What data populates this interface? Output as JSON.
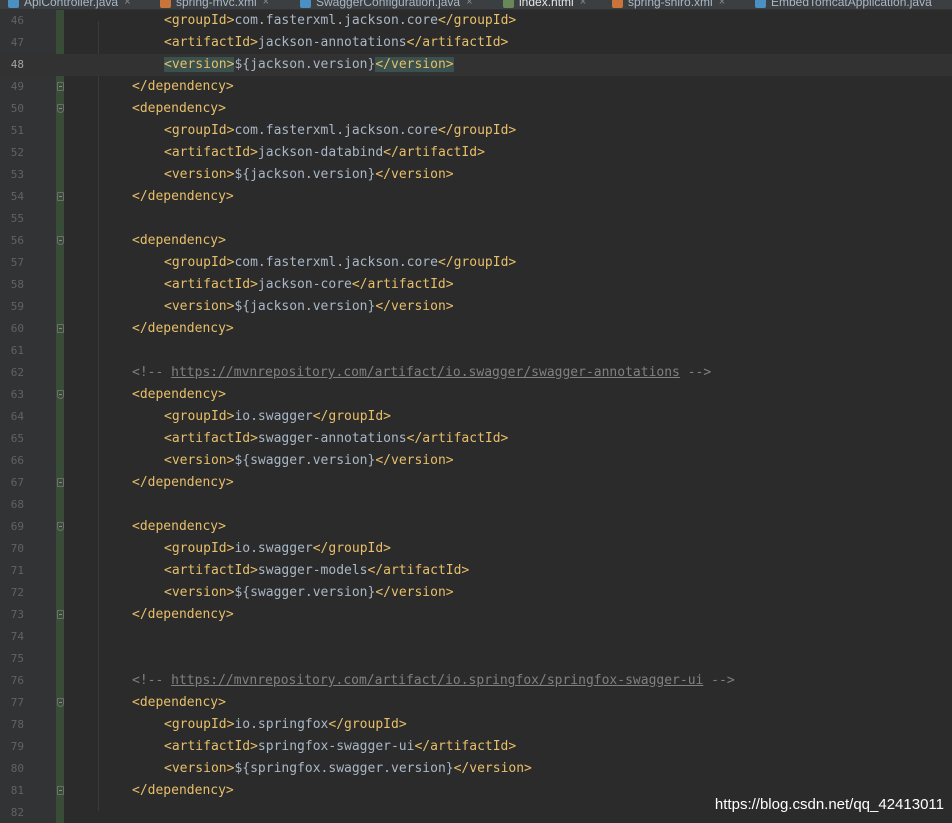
{
  "tabs": [
    {
      "label": "ApiController.java",
      "icon": "java-class-icon",
      "color": "#4a90c2",
      "active": false
    },
    {
      "label": "spring-mvc.xml",
      "icon": "spring-xml-icon",
      "color": "#c8743a",
      "active": false
    },
    {
      "label": "SwaggerConfiguration.java",
      "icon": "java-class-icon",
      "color": "#4a90c2",
      "active": false
    },
    {
      "label": "index.html",
      "icon": "html-file-icon",
      "color": "#6a8759",
      "active": true
    },
    {
      "label": "spring-shiro.xml",
      "icon": "spring-xml-icon",
      "color": "#c8743a",
      "active": false
    },
    {
      "label": "EmbedTomcatApplication.java",
      "icon": "java-class-icon",
      "color": "#4a90c2",
      "active": false
    }
  ],
  "editor": {
    "current_line": 48,
    "lines": [
      {
        "n": "46",
        "tokens": [
          {
            "c": "t",
            "s": "<groupId>"
          },
          {
            "c": "txt",
            "s": "com.fasterxml.jackson.core"
          },
          {
            "c": "t",
            "s": "</groupId>"
          }
        ]
      },
      {
        "n": "47",
        "tokens": [
          {
            "c": "t",
            "s": "<artifactId>"
          },
          {
            "c": "txt",
            "s": "jackson-annotations"
          },
          {
            "c": "t",
            "s": "</artifactId>"
          }
        ]
      },
      {
        "n": "48",
        "tokens": [
          {
            "c": "t hl",
            "s": "<version>"
          },
          {
            "c": "txt",
            "s": "${jackson.version}"
          },
          {
            "c": "t hl",
            "s": "</version>"
          }
        ]
      },
      {
        "n": "49",
        "tokens": [
          {
            "c": "t",
            "s": "</dependency>"
          }
        ]
      },
      {
        "n": "50",
        "tokens": [
          {
            "c": "t",
            "s": "<dependency>"
          }
        ]
      },
      {
        "n": "51",
        "tokens": [
          {
            "c": "t",
            "s": "<groupId>"
          },
          {
            "c": "txt",
            "s": "com.fasterxml.jackson.core"
          },
          {
            "c": "t",
            "s": "</groupId>"
          }
        ]
      },
      {
        "n": "52",
        "tokens": [
          {
            "c": "t",
            "s": "<artifactId>"
          },
          {
            "c": "txt",
            "s": "jackson-databind"
          },
          {
            "c": "t",
            "s": "</artifactId>"
          }
        ]
      },
      {
        "n": "53",
        "tokens": [
          {
            "c": "t",
            "s": "<version>"
          },
          {
            "c": "txt",
            "s": "${jackson.version}"
          },
          {
            "c": "t",
            "s": "</version>"
          }
        ]
      },
      {
        "n": "54",
        "tokens": [
          {
            "c": "t",
            "s": "</dependency>"
          }
        ]
      },
      {
        "n": "55",
        "tokens": []
      },
      {
        "n": "56",
        "tokens": [
          {
            "c": "t",
            "s": "<dependency>"
          }
        ]
      },
      {
        "n": "57",
        "tokens": [
          {
            "c": "t",
            "s": "<groupId>"
          },
          {
            "c": "txt",
            "s": "com.fasterxml.jackson.core"
          },
          {
            "c": "t",
            "s": "</groupId>"
          }
        ]
      },
      {
        "n": "58",
        "tokens": [
          {
            "c": "t",
            "s": "<artifactId>"
          },
          {
            "c": "txt",
            "s": "jackson-core"
          },
          {
            "c": "t",
            "s": "</artifactId>"
          }
        ]
      },
      {
        "n": "59",
        "tokens": [
          {
            "c": "t",
            "s": "<version>"
          },
          {
            "c": "txt",
            "s": "${jackson.version}"
          },
          {
            "c": "t",
            "s": "</version>"
          }
        ]
      },
      {
        "n": "60",
        "tokens": [
          {
            "c": "t",
            "s": "</dependency>"
          }
        ]
      },
      {
        "n": "61",
        "tokens": []
      },
      {
        "n": "62",
        "tokens": [
          {
            "c": "cmt",
            "s": "<!-- "
          },
          {
            "c": "url",
            "s": "https://mvnrepository.com/artifact/io.swagger/swagger-annotations"
          },
          {
            "c": "cmt",
            "s": " -->"
          }
        ]
      },
      {
        "n": "63",
        "tokens": [
          {
            "c": "t",
            "s": "<dependency>"
          }
        ]
      },
      {
        "n": "64",
        "tokens": [
          {
            "c": "t",
            "s": "<groupId>"
          },
          {
            "c": "txt",
            "s": "io.swagger"
          },
          {
            "c": "t",
            "s": "</groupId>"
          }
        ]
      },
      {
        "n": "65",
        "tokens": [
          {
            "c": "t",
            "s": "<artifactId>"
          },
          {
            "c": "txt",
            "s": "swagger-annotations"
          },
          {
            "c": "t",
            "s": "</artifactId>"
          }
        ]
      },
      {
        "n": "66",
        "tokens": [
          {
            "c": "t",
            "s": "<version>"
          },
          {
            "c": "txt",
            "s": "${swagger.version}"
          },
          {
            "c": "t",
            "s": "</version>"
          }
        ]
      },
      {
        "n": "67",
        "tokens": [
          {
            "c": "t",
            "s": "</dependency>"
          }
        ]
      },
      {
        "n": "68",
        "tokens": []
      },
      {
        "n": "69",
        "tokens": [
          {
            "c": "t",
            "s": "<dependency>"
          }
        ]
      },
      {
        "n": "70",
        "tokens": [
          {
            "c": "t",
            "s": "<groupId>"
          },
          {
            "c": "txt",
            "s": "io.swagger"
          },
          {
            "c": "t",
            "s": "</groupId>"
          }
        ]
      },
      {
        "n": "71",
        "tokens": [
          {
            "c": "t",
            "s": "<artifactId>"
          },
          {
            "c": "txt",
            "s": "swagger-models"
          },
          {
            "c": "t",
            "s": "</artifactId>"
          }
        ]
      },
      {
        "n": "72",
        "tokens": [
          {
            "c": "t",
            "s": "<version>"
          },
          {
            "c": "txt",
            "s": "${swagger.version}"
          },
          {
            "c": "t",
            "s": "</version>"
          }
        ]
      },
      {
        "n": "73",
        "tokens": [
          {
            "c": "t",
            "s": "</dependency>"
          }
        ]
      },
      {
        "n": "74",
        "tokens": []
      },
      {
        "n": "75",
        "tokens": []
      },
      {
        "n": "76",
        "tokens": [
          {
            "c": "cmt",
            "s": "<!-- "
          },
          {
            "c": "url",
            "s": "https://mvnrepository.com/artifact/io.springfox/springfox-swagger-ui"
          },
          {
            "c": "cmt",
            "s": " -->"
          }
        ]
      },
      {
        "n": "77",
        "tokens": [
          {
            "c": "t",
            "s": "<dependency>"
          }
        ]
      },
      {
        "n": "78",
        "tokens": [
          {
            "c": "t",
            "s": "<groupId>"
          },
          {
            "c": "txt",
            "s": "io.springfox"
          },
          {
            "c": "t",
            "s": "</groupId>"
          }
        ]
      },
      {
        "n": "79",
        "tokens": [
          {
            "c": "t",
            "s": "<artifactId>"
          },
          {
            "c": "txt",
            "s": "springfox-swagger-ui"
          },
          {
            "c": "t",
            "s": "</artifactId>"
          }
        ]
      },
      {
        "n": "80",
        "tokens": [
          {
            "c": "t",
            "s": "<version>"
          },
          {
            "c": "txt",
            "s": "${springfox.swagger.version}"
          },
          {
            "c": "t",
            "s": "</version>"
          }
        ]
      },
      {
        "n": "81",
        "tokens": [
          {
            "c": "t",
            "s": "</dependency>"
          }
        ]
      },
      {
        "n": "82",
        "tokens": []
      }
    ]
  },
  "watermark": "https://blog.csdn.net/qq_42413011",
  "colors": {
    "tag": "#e8bf6a",
    "text": "#a9b7c6",
    "comment": "#808080",
    "background": "#2b2b2b",
    "gutter": "#313335"
  }
}
